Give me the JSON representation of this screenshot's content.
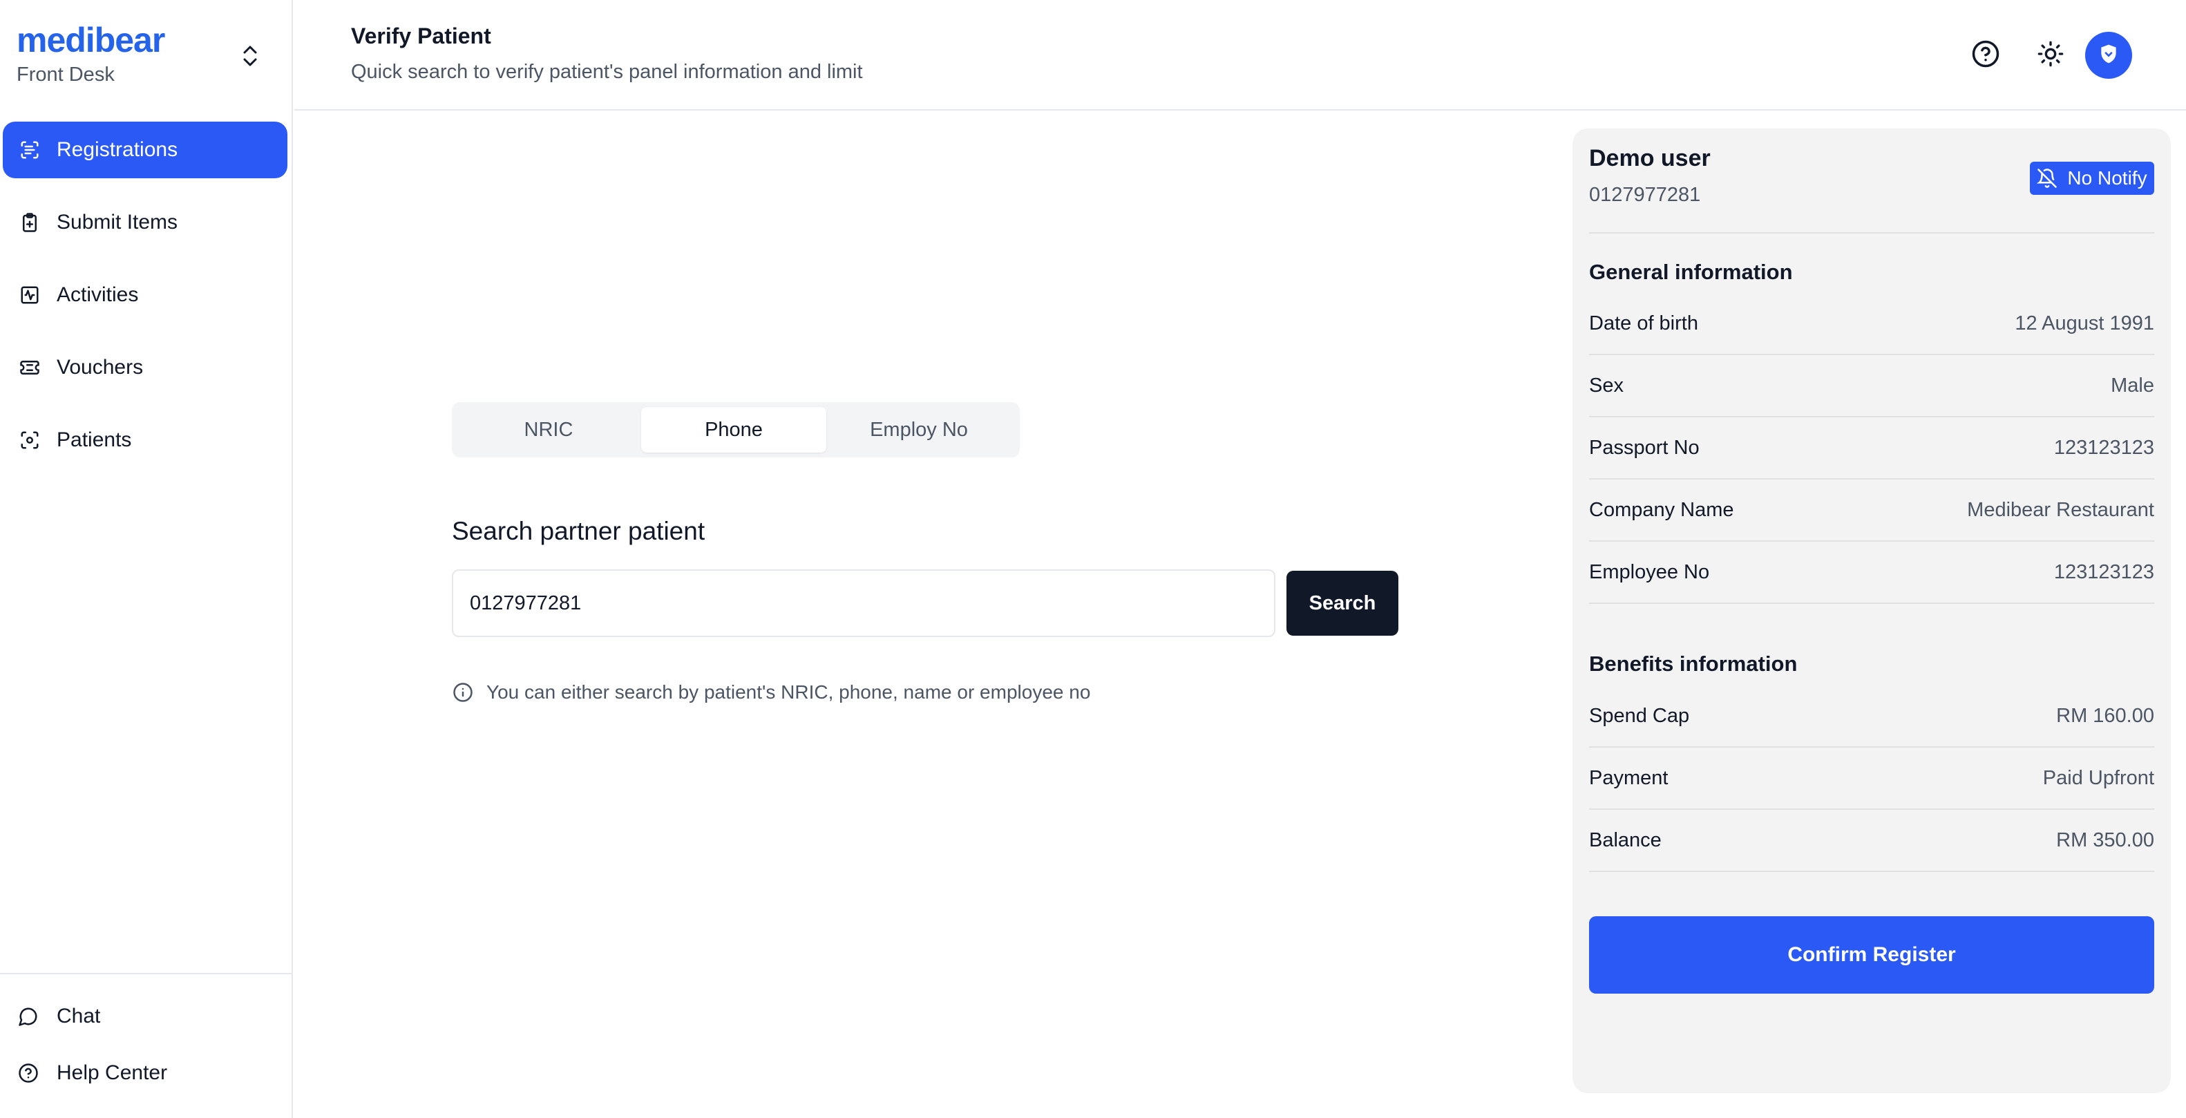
{
  "brand": {
    "name": "medibear",
    "role": "Front Desk"
  },
  "sidebar": {
    "items": [
      {
        "label": "Registrations",
        "icon": "scan-text-icon"
      },
      {
        "label": "Submit Items",
        "icon": "clipboard-plus-icon"
      },
      {
        "label": "Activities",
        "icon": "activity-square-icon"
      },
      {
        "label": "Vouchers",
        "icon": "ticket-icon"
      },
      {
        "label": "Patients",
        "icon": "scan-face-icon"
      }
    ],
    "bottom": [
      {
        "label": "Chat",
        "icon": "message-circle-icon"
      },
      {
        "label": "Help Center",
        "icon": "help-circle-icon"
      }
    ]
  },
  "header": {
    "title": "Verify Patient",
    "subtitle": "Quick search to verify patient's panel information and limit"
  },
  "search": {
    "tabs": [
      "NRIC",
      "Phone",
      "Employ No"
    ],
    "active_tab": "Phone",
    "label": "Search partner patient",
    "value": "0127977281",
    "button": "Search",
    "hint": "You can either search by patient's NRIC, phone, name or employee no"
  },
  "patient": {
    "name": "Demo user",
    "phone": "0127977281",
    "notify_label": "No Notify",
    "general_title": "General information",
    "general": [
      {
        "label": "Date of birth",
        "value": "12 August 1991"
      },
      {
        "label": "Sex",
        "value": "Male"
      },
      {
        "label": "Passport No",
        "value": "123123123"
      },
      {
        "label": "Company Name",
        "value": "Medibear Restaurant"
      },
      {
        "label": "Employee No",
        "value": "123123123"
      }
    ],
    "benefits_title": "Benefits information",
    "benefits": [
      {
        "label": "Spend Cap",
        "value": "RM 160.00"
      },
      {
        "label": "Payment",
        "value": "Paid Upfront"
      },
      {
        "label": "Balance",
        "value": "RM 350.00"
      }
    ],
    "confirm_label": "Confirm Register"
  },
  "colors": {
    "accent": "#2b59f5",
    "dark": "#111827",
    "panel": "#f3f3f3"
  }
}
